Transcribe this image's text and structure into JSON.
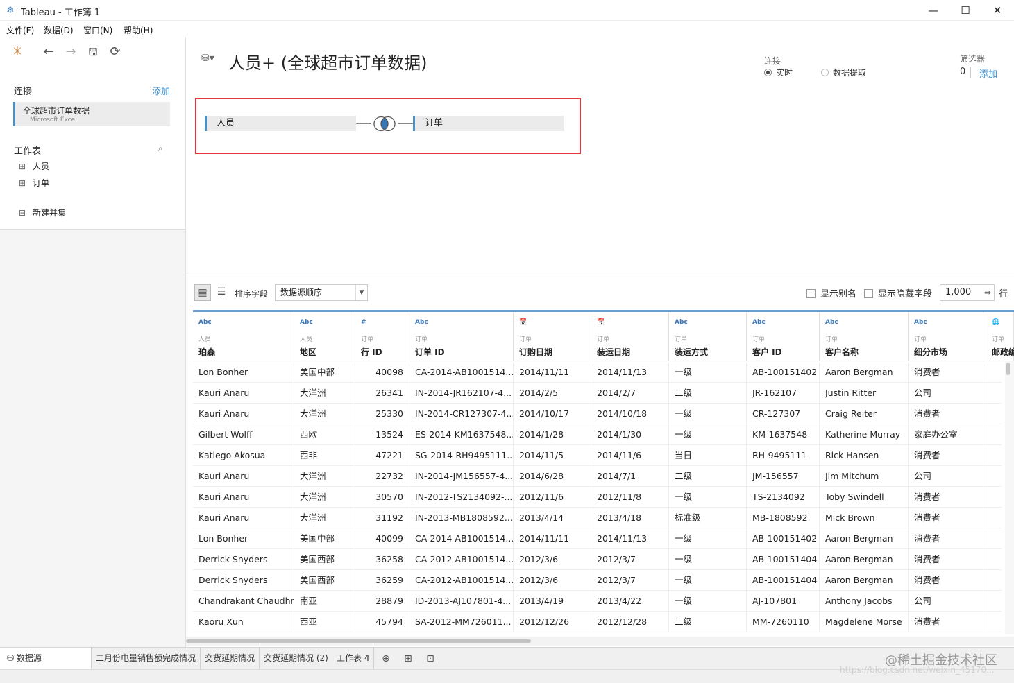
{
  "window": {
    "title": "Tableau - 工作簿 1",
    "minimize": "—",
    "maximize": "☐",
    "close": "✕"
  },
  "menu": [
    "文件(F)",
    "数据(D)",
    "窗口(N)",
    "帮助(H)"
  ],
  "left": {
    "connections_label": "连接",
    "add_label": "添加",
    "connection": {
      "name": "全球超市订单数据",
      "type": "Microsoft Excel"
    },
    "sheets_label": "工作表",
    "sheets": [
      "人员",
      "订单"
    ],
    "new_union": "新建并集"
  },
  "canvas": {
    "datasource_title": "人员+ (全球超市订单数据)",
    "connection_label": "连接",
    "live_label": "实时",
    "extract_label": "数据提取",
    "filters_label": "筛选器",
    "filters_count": "0",
    "filters_add": "添加",
    "left_table": "人员",
    "right_table": "订单",
    "join_type": "inner-join"
  },
  "toolbar": {
    "sort_label": "排序字段",
    "sort_value": "数据源顺序",
    "show_alias": "显示别名",
    "show_hidden": "显示隐藏字段",
    "rows_value": "1,000",
    "rows_unit": "行"
  },
  "grid": {
    "columns": [
      {
        "type": "Abc",
        "source": "人员",
        "name": "地区"
      },
      {
        "type": "#",
        "source": "订单",
        "name": "行 ID"
      },
      {
        "type": "Abc",
        "source": "订单",
        "name": "订单 ID"
      },
      {
        "type": "📅",
        "source": "订单",
        "name": "订购日期"
      },
      {
        "type": "📅",
        "source": "订单",
        "name": "装运日期"
      },
      {
        "type": "Abc",
        "source": "订单",
        "name": "装运方式"
      },
      {
        "type": "Abc",
        "source": "订单",
        "name": "客户 ID"
      },
      {
        "type": "Abc",
        "source": "订单",
        "name": "客户名称"
      },
      {
        "type": "Abc",
        "source": "订单",
        "name": "细分市场"
      },
      {
        "type": "🌐",
        "source": "订单",
        "name": "邮政编"
      }
    ],
    "first_column": {
      "type": "Abc",
      "source": "人员",
      "name": "珀森"
    },
    "rows": [
      [
        "Lon Bonher",
        "美国中部",
        "40098",
        "CA-2014-AB1001514...",
        "2014/11/11",
        "2014/11/13",
        "一级",
        "AB-100151402",
        "Aaron Bergman",
        "消费者"
      ],
      [
        "Kauri Anaru",
        "大洋洲",
        "26341",
        "IN-2014-JR162107-4...",
        "2014/2/5",
        "2014/2/7",
        "二级",
        "JR-162107",
        "Justin Ritter",
        "公司"
      ],
      [
        "Kauri Anaru",
        "大洋洲",
        "25330",
        "IN-2014-CR127307-4...",
        "2014/10/17",
        "2014/10/18",
        "一级",
        "CR-127307",
        "Craig Reiter",
        "消费者"
      ],
      [
        "Gilbert Wolff",
        "西欧",
        "13524",
        "ES-2014-KM1637548...",
        "2014/1/28",
        "2014/1/30",
        "一级",
        "KM-1637548",
        "Katherine Murray",
        "家庭办公室"
      ],
      [
        "Katlego Akosua",
        "西非",
        "47221",
        "SG-2014-RH9495111...",
        "2014/11/5",
        "2014/11/6",
        "当日",
        "RH-9495111",
        "Rick Hansen",
        "消费者"
      ],
      [
        "Kauri Anaru",
        "大洋洲",
        "22732",
        "IN-2014-JM156557-4...",
        "2014/6/28",
        "2014/7/1",
        "二级",
        "JM-156557",
        "Jim Mitchum",
        "公司"
      ],
      [
        "Kauri Anaru",
        "大洋洲",
        "30570",
        "IN-2012-TS2134092-...",
        "2012/11/6",
        "2012/11/8",
        "一级",
        "TS-2134092",
        "Toby Swindell",
        "消费者"
      ],
      [
        "Kauri Anaru",
        "大洋洲",
        "31192",
        "IN-2013-MB1808592...",
        "2013/4/14",
        "2013/4/18",
        "标准级",
        "MB-1808592",
        "Mick Brown",
        "消费者"
      ],
      [
        "Lon Bonher",
        "美国中部",
        "40099",
        "CA-2014-AB1001514...",
        "2014/11/11",
        "2014/11/13",
        "一级",
        "AB-100151402",
        "Aaron Bergman",
        "消费者"
      ],
      [
        "Derrick Snyders",
        "美国西部",
        "36258",
        "CA-2012-AB1001514...",
        "2012/3/6",
        "2012/3/7",
        "一级",
        "AB-100151404",
        "Aaron Bergman",
        "消费者"
      ],
      [
        "Derrick Snyders",
        "美国西部",
        "36259",
        "CA-2012-AB1001514...",
        "2012/3/6",
        "2012/3/7",
        "一级",
        "AB-100151404",
        "Aaron Bergman",
        "消费者"
      ],
      [
        "Chandrakant Chaudhri",
        "南亚",
        "28879",
        "ID-2013-AJ107801-4...",
        "2013/4/19",
        "2013/4/22",
        "一级",
        "AJ-107801",
        "Anthony Jacobs",
        "公司"
      ],
      [
        "Kaoru Xun",
        "西亚",
        "45794",
        "SA-2012-MM726011...",
        "2012/12/26",
        "2012/12/28",
        "二级",
        "MM-7260110",
        "Magdelene Morse",
        "消费者"
      ]
    ]
  },
  "bottom_tabs": [
    "数据源",
    "二月份电量销售额完成情况",
    "交货延期情况",
    "交货延期情况 (2)",
    "工作表 4"
  ],
  "watermark": "@稀土掘金技术社区",
  "watermark_url": "https://blog.csdn.net/weixin_45170..."
}
